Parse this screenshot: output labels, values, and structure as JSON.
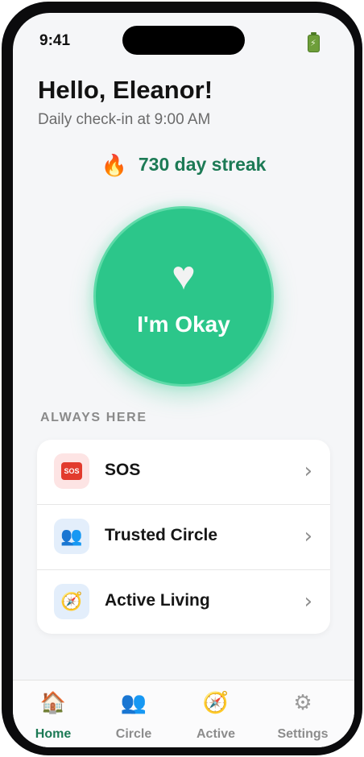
{
  "status_bar": {
    "time": "9:41"
  },
  "header": {
    "greeting": "Hello, Eleanor!",
    "subtitle": "Daily check-in at 9:00 AM"
  },
  "streak": {
    "icon": "fire-icon",
    "label": "730 day streak"
  },
  "checkin_button": {
    "icon": "heart-icon",
    "label": "I'm Okay"
  },
  "section": {
    "title": "ALWAYS HERE",
    "items": [
      {
        "icon": "sos-icon",
        "label": "SOS"
      },
      {
        "icon": "people-icon",
        "label": "Trusted Circle"
      },
      {
        "icon": "compass-icon",
        "label": "Active Living"
      }
    ]
  },
  "tab_bar": {
    "items": [
      {
        "icon": "house-icon",
        "label": "Home",
        "active": true
      },
      {
        "icon": "people-icon",
        "label": "Circle",
        "active": false
      },
      {
        "icon": "compass-icon",
        "label": "Active",
        "active": false
      },
      {
        "icon": "gear-icon",
        "label": "Settings",
        "active": false
      }
    ]
  },
  "colors": {
    "accent": "#2cc68a",
    "accent_text": "#1c7a55",
    "sos_red": "#e23b2e",
    "background": "#f5f6f8"
  }
}
